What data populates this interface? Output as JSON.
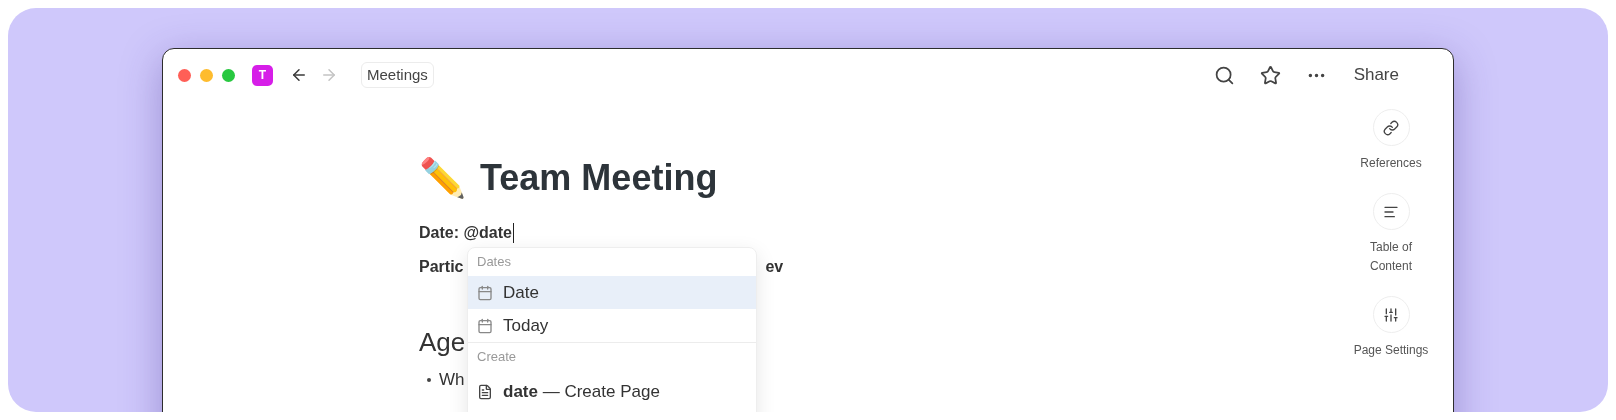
{
  "window": {
    "traffic_lights": [
      {
        "color": "#ff5f57"
      },
      {
        "color": "#febc2e"
      },
      {
        "color": "#28c840"
      }
    ],
    "app_badge": "T",
    "nav": [
      {
        "kind": "back",
        "disabled": false
      },
      {
        "kind": "forward",
        "disabled": true
      }
    ],
    "breadcrumb": "Meetings",
    "actions": [
      {
        "kind": "search"
      },
      {
        "kind": "star"
      },
      {
        "kind": "more"
      }
    ],
    "share": "Share"
  },
  "page": {
    "emoji": "✏️",
    "title": "Team Meeting",
    "date_line": "Date: @date",
    "participants_line": {
      "start": "Partic",
      "end": "ev"
    },
    "agenda_heading": "Age",
    "bullets": [
      "Wh"
    ]
  },
  "mention_menu": {
    "sections": [
      {
        "header": "Dates",
        "items": [
          {
            "kind": "calendar",
            "label": "Date",
            "selected": true
          },
          {
            "kind": "calendar",
            "label": "Today",
            "selected": false
          }
        ]
      },
      {
        "header": "Create",
        "items": [
          {
            "kind": "page",
            "label": "**date** — Create Page",
            "selected": false
          }
        ]
      }
    ]
  },
  "sidebar": [
    {
      "kind": "link",
      "label": "References"
    },
    {
      "kind": "toc",
      "label": "Table of Content"
    },
    {
      "kind": "settings",
      "label": "Page Settings"
    }
  ]
}
